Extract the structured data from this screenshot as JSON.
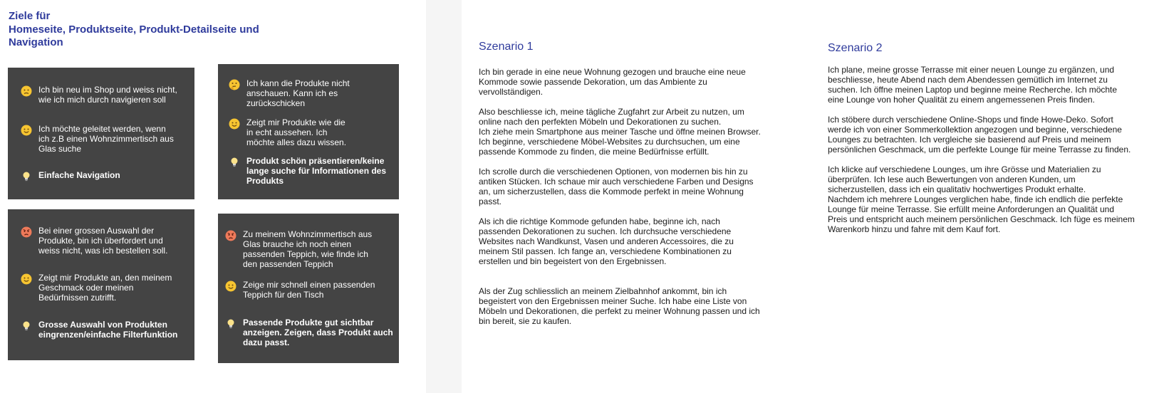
{
  "goals": {
    "title_lines": [
      "Ziele für",
      "Homeseite, Produktseite, Produkt-Detailseite und",
      "Navigation"
    ]
  },
  "cards": [
    {
      "items": [
        {
          "icon": "sad-face-icon",
          "text": "Ich bin neu im Shop und weiss nicht,\nwie ich mich durch navigieren soll"
        },
        {
          "icon": "smiling-face-icon",
          "text": "Ich möchte geleitet werden, wenn\nich z.B einen Wohnzimmertisch aus\nGlas suche"
        },
        {
          "icon": "lightbulb-icon",
          "text": "Einfache Navigation"
        }
      ]
    },
    {
      "items": [
        {
          "icon": "thinking-face-icon",
          "text": "Ich kann die Produkte nicht\nanschauen. Kann ich es\nzurückschicken"
        },
        {
          "icon": "smiling-face-icon",
          "text": "Zeigt mir Produkte wie die\nin echt aussehen. Ich\nmöchte alles dazu wissen."
        },
        {
          "icon": "lightbulb-icon",
          "text": "Produkt schön präsentieren/keine\nlange suche für Informationen des\nProdukts"
        }
      ]
    },
    {
      "items": [
        {
          "icon": "angry-face-icon",
          "text": "Bei einer grossen Auswahl der\nProdukte, bin ich überfordert und\nweiss nicht, was ich bestellen soll."
        },
        {
          "icon": "smiling-face-icon",
          "text": "Zeigt mir Produkte an, den meinem\nGeschmack oder meinen\nBedürfnissen zutrifft."
        },
        {
          "icon": "lightbulb-icon",
          "text": "Grosse Auswahl von Produkten\neingrenzen/einfache Filterfunktion"
        }
      ]
    },
    {
      "items": [
        {
          "icon": "angry-face-icon",
          "text": "Zu meinem Wohnzimmertisch aus\nGlas brauche ich noch einen\npassenden Teppich, wie finde ich\nden passenden Teppich"
        },
        {
          "icon": "smiling-face-icon",
          "text": "Zeige mir schnell einen passenden\nTeppich für den Tisch"
        },
        {
          "icon": "lightbulb-icon",
          "text": "Passende Produkte gut sichtbar\nanzeigen. Zeigen, dass Produkt auch\ndazu passt."
        }
      ]
    }
  ],
  "scenario1": {
    "title": "Szenario 1",
    "paragraphs": [
      "Ich bin gerade in eine neue Wohnung gezogen und brauche eine neue\nKommode sowie passende Dekoration, um das Ambiente zu\nvervollständigen.",
      "Also beschliesse ich, meine tägliche Zugfahrt zur Arbeit zu nutzen, um\nonline nach den perfekten Möbeln und Dekorationen zu suchen.\nIch ziehe mein Smartphone aus meiner Tasche und öffne meinen Browser.\nIch beginne, verschiedene Möbel-Websites zu durchsuchen, um eine\npassende Kommode zu finden, die meine Bedürfnisse erfüllt.",
      "Ich scrolle durch die verschiedenen Optionen, von modernen bis hin zu\nantiken Stücken. Ich schaue mir auch verschiedene Farben und Designs\nan, um sicherzustellen, dass die Kommode perfekt in meine Wohnung\npasst.",
      "Als ich die richtige Kommode gefunden habe, beginne ich, nach\npassenden Dekorationen zu suchen. Ich durchsuche verschiedene\nWebsites nach Wandkunst, Vasen und anderen Accessoires, die zu\nmeinem Stil passen. Ich fange an, verschiedene Kombinationen zu\nerstellen und bin begeistert von den Ergebnissen.",
      "Als der Zug schliesslich an meinem Zielbahnhof ankommt, bin ich\nbegeistert von den Ergebnissen meiner Suche. Ich habe eine Liste von\nMöbeln und Dekorationen, die perfekt zu meiner Wohnung passen und ich\nbin bereit, sie zu kaufen."
    ]
  },
  "scenario2": {
    "title": "Szenario 2",
    "paragraphs": [
      "Ich plane, meine grosse Terrasse mit einer neuen Lounge zu ergänzen, und\nbeschliesse, heute Abend nach dem Abendessen gemütlich im Internet zu\nsuchen. Ich öffne meinen Laptop und beginne meine Recherche. Ich möchte\neine Lounge von hoher Qualität zu einem angemessenen Preis finden.",
      "Ich stöbere durch verschiedene Online-Shops und finde Howe-Deko. Sofort\nwerde ich von einer Sommerkollektion angezogen und beginne, verschiedene\nLounges zu betrachten. Ich vergleiche sie basierend auf Preis und meinem\npersönlichen Geschmack, um die perfekte Lounge für meine Terrasse zu finden.",
      "Ich klicke auf verschiedene Lounges, um ihre Grösse und Materialien zu\nüberprüfen. Ich lese auch Bewertungen von anderen Kunden, um\nsicherzustellen, dass ich ein qualitativ hochwertiges Produkt erhalte.\nNachdem ich mehrere Lounges verglichen habe, finde ich endlich die perfekte\nLounge für meine Terrasse. Sie erfüllt meine Anforderungen an Qualität und\nPreis und entspricht auch meinem persönlichen Geschmack. Ich füge es meinem\nWarenkorb hinzu und fahre mit dem Kauf fort."
    ]
  }
}
